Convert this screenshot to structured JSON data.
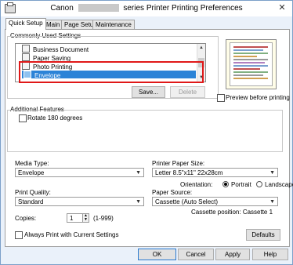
{
  "window": {
    "title_prefix": "Canon",
    "title_suffix": "series Printer Printing Preferences",
    "close_label": "✕"
  },
  "tabs": [
    {
      "label": "Quick Setup",
      "active": true
    },
    {
      "label": "Main",
      "active": false
    },
    {
      "label": "Page Setup",
      "active": false
    },
    {
      "label": "Maintenance",
      "active": false
    }
  ],
  "commonly_used": {
    "label": "Commonly Used Settings",
    "items": [
      {
        "label": "Business Document",
        "selected": false
      },
      {
        "label": "Paper Saving",
        "selected": false
      },
      {
        "label": "Photo Printing",
        "selected": false
      },
      {
        "label": "Envelope",
        "selected": true
      }
    ],
    "save_label": "Save...",
    "delete_label": "Delete"
  },
  "preview": {
    "checkbox_label": "Preview before printing",
    "checked": false
  },
  "additional_features": {
    "label": "Additional Features",
    "rotate_label": "Rotate 180 degrees",
    "rotate_checked": false
  },
  "media_type": {
    "label": "Media Type:",
    "value": "Envelope"
  },
  "printer_paper_size": {
    "label": "Printer Paper Size:",
    "value": "Letter 8.5\"x11\" 22x28cm"
  },
  "orientation": {
    "label": "Orientation:",
    "options": [
      "Portrait",
      "Landscape"
    ],
    "selected": "Portrait"
  },
  "print_quality": {
    "label": "Print Quality:",
    "value": "Standard"
  },
  "paper_source": {
    "label": "Paper Source:",
    "value": "Cassette (Auto Select)",
    "cassette_position": "Cassette position: Cassette 1"
  },
  "copies": {
    "label": "Copies:",
    "value": "1",
    "range": "(1-999)"
  },
  "always_print": {
    "label": "Always Print with Current Settings",
    "checked": false
  },
  "buttons": {
    "defaults": "Defaults",
    "ok": "OK",
    "cancel": "Cancel",
    "apply": "Apply",
    "help": "Help"
  },
  "colors": {
    "selection": "#2b83d7",
    "highlight_border": "#e01818",
    "panel_background": "#eaf1fa"
  },
  "icons": {
    "window_icon": "printer-icon",
    "list_item_icon": "document-icon"
  }
}
